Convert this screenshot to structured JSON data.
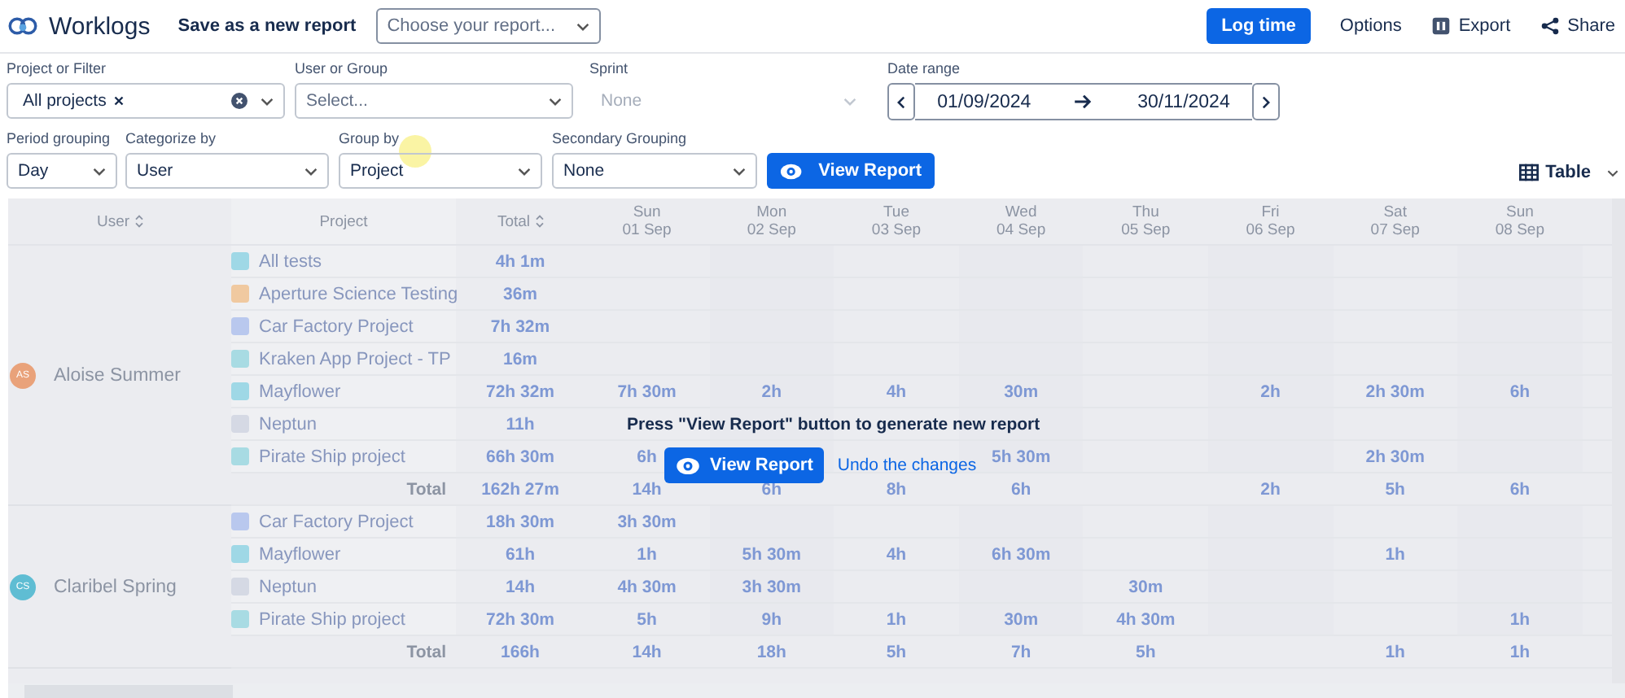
{
  "header": {
    "title": "Worklogs",
    "save_link": "Save as a new report",
    "report_select": {
      "placeholder": "Choose your report..."
    },
    "actions": [
      {
        "kind": "primary",
        "label": "Log time"
      },
      {
        "kind": "plain",
        "label": "Options"
      },
      {
        "kind": "export",
        "label": "Export"
      },
      {
        "kind": "share",
        "label": "Share"
      }
    ]
  },
  "filters": [
    {
      "label": "Project or Filter",
      "kind": "tags",
      "tag": "All projects"
    },
    {
      "label": "User or Group",
      "kind": "select",
      "placeholder": "Select..."
    },
    {
      "label": "Sprint",
      "kind": "select",
      "value": "None",
      "disabled": true
    },
    {
      "label": "Date range",
      "kind": "dates",
      "from": "01/09/2024",
      "to": "30/11/2024"
    }
  ],
  "grouping": [
    {
      "label": "Period grouping",
      "value": "Day"
    },
    {
      "label": "Categorize by",
      "value": "User"
    },
    {
      "label": "Group by",
      "value": "Project"
    },
    {
      "label": "Secondary Grouping",
      "value": "None"
    }
  ],
  "view_button": "View Report",
  "view_mode": "Table",
  "table": {
    "columns": [
      {
        "label": "User",
        "kind": "sort"
      },
      {
        "label": "Project",
        "kind": "plain"
      },
      {
        "label": "Total",
        "kind": "sort"
      },
      {
        "label": "Sun",
        "date": "01 Sep",
        "kind": "day"
      },
      {
        "label": "Mon",
        "date": "02 Sep",
        "kind": "day"
      },
      {
        "label": "Tue",
        "date": "03 Sep",
        "kind": "day"
      },
      {
        "label": "Wed",
        "date": "04 Sep",
        "kind": "day"
      },
      {
        "label": "Thu",
        "date": "05 Sep",
        "kind": "day"
      },
      {
        "label": "Fri",
        "date": "06 Sep",
        "kind": "day"
      },
      {
        "label": "Sat",
        "date": "07 Sep",
        "kind": "day"
      },
      {
        "label": "Sun",
        "date": "08 Sep",
        "kind": "day"
      }
    ],
    "groups": [
      {
        "user": "Aloise Summer",
        "initials": "AS",
        "color": "#e9a27a",
        "rows": [
          {
            "project": "All tests",
            "color": "#9fd8e6",
            "total": "4h 1m"
          },
          {
            "project": "Aperture Science Testing",
            "color": "#f0c9a0",
            "total": "36m"
          },
          {
            "project": "Car Factory Project",
            "color": "#b9c8ee",
            "total": "7h 32m"
          },
          {
            "project": "Kraken App Project - TP",
            "color": "#a8dbe3",
            "total": "16m"
          },
          {
            "project": "Mayflower",
            "color": "#9fd8e6",
            "total": "72h 32m",
            "days": {
              "d0": "7h 30m",
              "d1": "2h",
              "d2": "4h",
              "d3": "30m",
              "d5": "2h",
              "d6": "2h 30m",
              "d7": "6h"
            }
          },
          {
            "project": "Neptun",
            "color": "#d5d9e4",
            "total": "11h"
          },
          {
            "project": "Pirate Ship project",
            "color": "#a8dbe3",
            "total": "66h 30m",
            "days": {
              "d0": "6h",
              "d3": "5h 30m",
              "d6": "2h 30m"
            }
          }
        ],
        "total_row": {
          "label": "Total",
          "total": "162h 27m",
          "days": {
            "d0": "14h",
            "d1": "6h",
            "d2": "8h",
            "d3": "6h",
            "d5": "2h",
            "d6": "5h",
            "d7": "6h"
          }
        }
      },
      {
        "user": "Claribel Spring",
        "initials": "CS",
        "color": "#5fbdd3",
        "rows": [
          {
            "project": "Car Factory Project",
            "color": "#b9c8ee",
            "total": "18h 30m",
            "days": {
              "d0": "3h 30m"
            }
          },
          {
            "project": "Mayflower",
            "color": "#9fd8e6",
            "total": "61h",
            "days": {
              "d0": "1h",
              "d1": "5h 30m",
              "d2": "4h",
              "d3": "6h 30m",
              "d6": "1h"
            }
          },
          {
            "project": "Neptun",
            "color": "#d5d9e4",
            "total": "14h",
            "days": {
              "d0": "4h 30m",
              "d1": "3h 30m",
              "d4": "30m"
            }
          },
          {
            "project": "Pirate Ship project",
            "color": "#a8dbe3",
            "total": "72h 30m",
            "days": {
              "d0": "5h",
              "d1": "9h",
              "d2": "1h",
              "d3": "30m",
              "d4": "4h 30m",
              "d7": "1h"
            }
          }
        ],
        "total_row": {
          "label": "Total",
          "total": "166h",
          "days": {
            "d0": "14h",
            "d1": "18h",
            "d2": "5h",
            "d3": "7h",
            "d4": "5h",
            "d6": "1h",
            "d7": "1h"
          }
        }
      }
    ]
  },
  "overlay": {
    "message": "Press \"View Report\" button to generate new report",
    "button": "View Report",
    "link": "Undo the changes"
  }
}
